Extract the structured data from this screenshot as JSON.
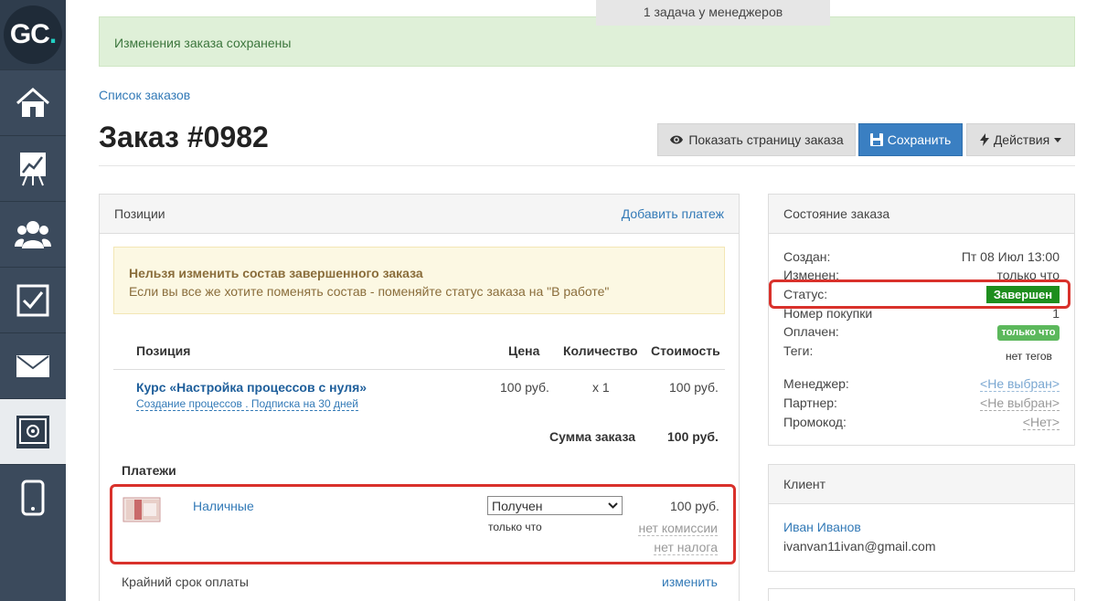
{
  "app": {
    "logo_text": "GC",
    "logo_dot": "."
  },
  "sidebar": {
    "items": [
      {
        "icon": "home-icon"
      },
      {
        "icon": "chart-board-icon"
      },
      {
        "icon": "users-icon"
      },
      {
        "icon": "checkbox-icon"
      },
      {
        "icon": "mail-icon"
      },
      {
        "icon": "safe-icon",
        "active": true
      },
      {
        "icon": "mobile-icon"
      }
    ]
  },
  "top_notice": "1 задача у менеджеров",
  "alert_success": "Изменения заказа сохранены",
  "breadcrumb": "Список заказов",
  "page_title": "Заказ #0982",
  "toolbar": {
    "view_label": "Показать страницу заказа",
    "save_label": "Сохранить",
    "actions_label": "Действия"
  },
  "positions": {
    "header": "Позиции",
    "add_payment": "Добавить платеж",
    "warning_title": "Нельзя изменить состав завершенного заказа",
    "warning_text": "Если вы все же хотите поменять состав - поменяйте статус заказа на \"В работе\"",
    "columns": {
      "position": "Позиция",
      "price": "Цена",
      "quantity": "Количество",
      "cost": "Стоимость"
    },
    "item": {
      "name": "Курс «Настройка процессов с нуля»",
      "sub": "Создание процессов . Подписка на 30 дней",
      "price": "100 руб.",
      "quantity": "x 1",
      "cost": "100 руб."
    },
    "sum_label": "Сумма заказа",
    "sum_value": "100 руб."
  },
  "payments": {
    "title": "Платежи",
    "method": "Наличные",
    "status_value": "Получен",
    "time": "только что",
    "amount": "100 руб.",
    "no_fee": "нет комиссии",
    "no_tax": "нет налога",
    "deadline_label": "Крайний срок оплаты",
    "change_link": "изменить"
  },
  "order_state": {
    "header": "Состояние заказа",
    "created_label": "Создан:",
    "created_value": "Пт 08 Июл 13:00",
    "changed_label": "Изменен:",
    "changed_value": "только что",
    "status_label": "Статус:",
    "status_value": "Завершен",
    "purchase_label": "Номер покупки",
    "purchase_value": "1",
    "paid_label": "Оплачен:",
    "paid_value": "только что",
    "tags_label": "Теги:",
    "tags_value": "нет тегов",
    "manager_label": "Менеджер:",
    "manager_value": "<Не выбран>",
    "partner_label": "Партнер:",
    "partner_value": "<Не выбран>",
    "promo_label": "Промокод:",
    "promo_value": "<Нет>"
  },
  "client": {
    "header": "Клиент",
    "name": "Иван Иванов",
    "email": "ivanvan11ivan@gmail.com"
  },
  "colors": {
    "primary": "#3a7fc2",
    "success_bg": "#dff0d8",
    "highlight": "#d9312b",
    "done": "#1e8e1e"
  }
}
